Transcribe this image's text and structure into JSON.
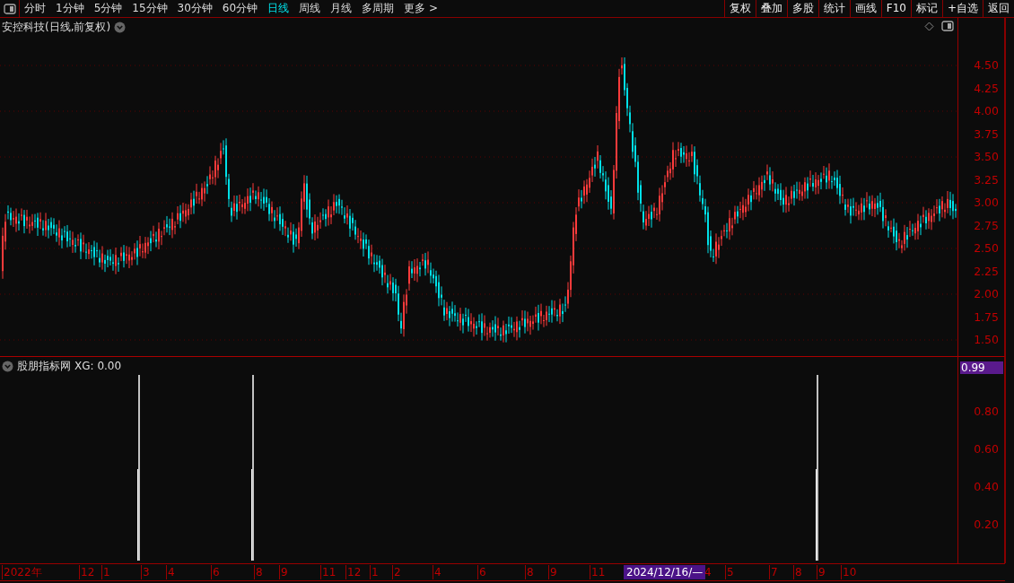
{
  "toolbar": {
    "periods": [
      {
        "label": "分时",
        "selected": false
      },
      {
        "label": "1分钟",
        "selected": false
      },
      {
        "label": "5分钟",
        "selected": false
      },
      {
        "label": "15分钟",
        "selected": false
      },
      {
        "label": "30分钟",
        "selected": false
      },
      {
        "label": "60分钟",
        "selected": false
      },
      {
        "label": "日线",
        "selected": true
      },
      {
        "label": "周线",
        "selected": false
      },
      {
        "label": "月线",
        "selected": false
      },
      {
        "label": "多周期",
        "selected": false
      },
      {
        "label": "更多 >",
        "selected": false
      }
    ],
    "actions": [
      "复权",
      "叠加",
      "多股",
      "统计",
      "画线",
      "F10",
      "标记",
      "+自选",
      "返回"
    ]
  },
  "price_panel": {
    "title": "安控科技(日线,前复权)",
    "axis": [
      "4.50",
      "4.25",
      "4.00",
      "3.75",
      "3.50",
      "3.25",
      "3.00",
      "2.75",
      "2.50",
      "2.25",
      "2.00",
      "1.75",
      "1.50"
    ]
  },
  "indicator_panel": {
    "name": "股朋指标网",
    "reading": "XG: 0.00",
    "cursor_value": "0.99",
    "axis": [
      "0.80",
      "0.60",
      "0.40",
      "0.20"
    ]
  },
  "date_axis": {
    "labels": [
      "2022年",
      "12",
      "1",
      "3",
      "4",
      "6",
      "8",
      "9",
      "11",
      "12",
      "1",
      "2",
      "4",
      "6",
      "8",
      "9",
      "11",
      "4",
      "5",
      "7",
      "8",
      "9",
      "10"
    ],
    "cursor_date": "2024/12/16/—"
  }
}
